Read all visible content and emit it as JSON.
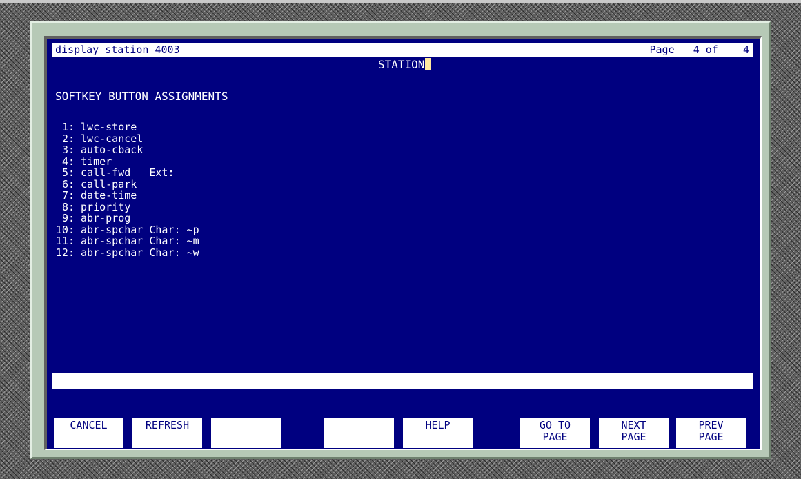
{
  "header": {
    "title": "display station 4003",
    "page_label": "Page",
    "page_current": "4",
    "page_of": "of",
    "page_total": "4"
  },
  "form_name": "STATION",
  "section_title": "SOFTKEY BUTTON ASSIGNMENTS",
  "softkeys": [
    {
      "number": "1:",
      "value": "lwc-store"
    },
    {
      "number": "2:",
      "value": "lwc-cancel"
    },
    {
      "number": "3:",
      "value": "auto-cback"
    },
    {
      "number": "4:",
      "value": "timer"
    },
    {
      "number": "5:",
      "value": "call-fwd   Ext:"
    },
    {
      "number": "6:",
      "value": "call-park"
    },
    {
      "number": "7:",
      "value": "date-time"
    },
    {
      "number": "8:",
      "value": "priority"
    },
    {
      "number": "9:",
      "value": "abr-prog"
    },
    {
      "number": "10:",
      "value": "abr-spchar Char: ~p"
    },
    {
      "number": "11:",
      "value": "abr-spchar Char: ~m"
    },
    {
      "number": "12:",
      "value": "abr-spchar Char: ~w"
    }
  ],
  "message_line": "",
  "function_keys": [
    {
      "line1": "CANCEL",
      "line2": ""
    },
    {
      "line1": "REFRESH",
      "line2": ""
    },
    {
      "line1": "",
      "line2": ""
    },
    {
      "line1": "",
      "line2": ""
    },
    {
      "line1": "HELP",
      "line2": ""
    },
    {
      "line1": "GO TO",
      "line2": "PAGE"
    },
    {
      "line1": "NEXT",
      "line2": "PAGE"
    },
    {
      "line1": "PREV",
      "line2": "PAGE"
    }
  ],
  "colors": {
    "screen_background": "#000080",
    "text": "#ffffff",
    "cursor": "#ffe8a0",
    "frame": "#b6c9b6"
  }
}
